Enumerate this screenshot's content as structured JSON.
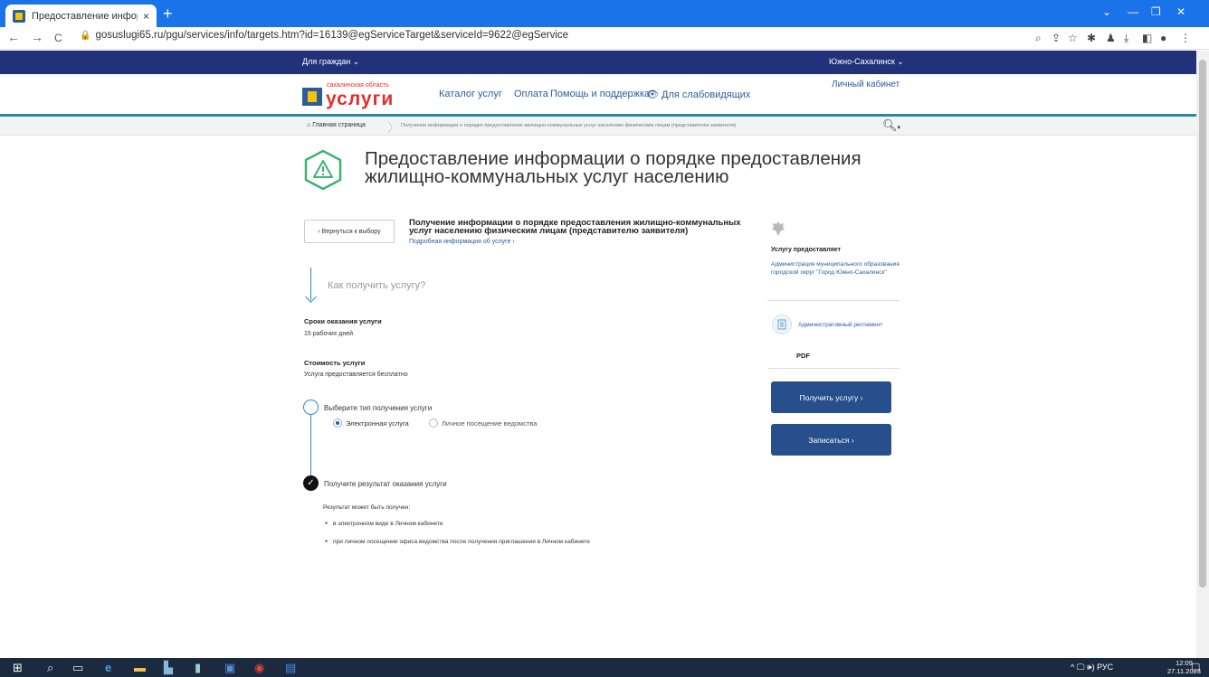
{
  "browser": {
    "tab_title": "Предоставление информации о",
    "tab_close": "×",
    "new_tab": "+",
    "url": "gosuslugi65.ru/pgu/services/info/targets.htm?id=16139@egServiceTarget&serviceId=9622@egService",
    "window_controls": [
      "⌄",
      "—",
      "❐",
      "✕"
    ],
    "nav": {
      "back": "←",
      "forward": "→",
      "reload": "C"
    }
  },
  "site": {
    "topnav_left": "Для граждан ⌄",
    "topnav_right": "Южно-Сахалинск ⌄",
    "logo_small": "сахалинская область",
    "logo_big": "услуги",
    "nav": {
      "catalog": "Каталог услуг",
      "payment": "Оплата",
      "help": "Помощь и поддержка",
      "accessibility": "Для слабовидящих"
    },
    "cabinet": "Личный кабинет"
  },
  "breadcrumb": {
    "home": "Главная страница",
    "current": "Получение информации о порядке предоставления жилищно-коммунальных услуг населению физическим лицам (представителю заявителя)"
  },
  "page": {
    "title": "Предоставление информации о порядке предоставления жилищно-коммунальных услуг населению",
    "back_button": "‹  Вернуться к выбору",
    "service_name": "Получение информации о порядке предоставления жилищно-коммунальных услуг населению физическим лицам (представителю заявителя)",
    "service_more": "Подробная информация об услуге ›",
    "how_to": "Как получить услугу?",
    "terms_label": "Сроки оказания услуги",
    "terms_value": "15 рабочих дней",
    "cost_label": "Стоимость услуги",
    "cost_value": "Услуга предоставляется бесплатно",
    "step1_label": "Выберите тип получения услуги",
    "radio_electronic": "Электронная услуга",
    "radio_visit": "Личное посещение ведомства",
    "step2_label": "Получите результат оказания услуги",
    "result_intro": "Результат может быть получен:",
    "result_items": [
      "в электронном виде в Личном кабинете",
      "при личном посещении офиса ведомства после получения приглашения в Личном кабинете"
    ]
  },
  "sidebar": {
    "provider_label": "Услугу предоставляет",
    "provider_name": "Администрация муниципального образования городской округ \"Город Южно-Сахалинск\"",
    "regulation_link": "Административный регламент",
    "regulation_format": "PDF",
    "get_service_button": "Получить услугу  ›",
    "signup_button": "Записаться  ›"
  },
  "taskbar": {
    "tray": "^  🖵  🕪)  РУС",
    "time": "12:09",
    "date": "27.11.2023"
  },
  "colors": {
    "chrome_blue": "#1a73e8",
    "site_navy": "#21327a",
    "accent_teal": "#2a8a9a",
    "button_blue": "#264f8c",
    "logo_red": "#e0302c"
  }
}
